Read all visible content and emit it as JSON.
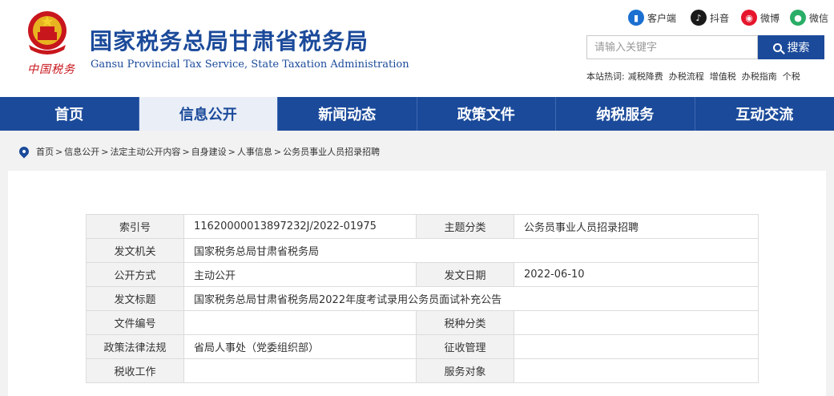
{
  "header": {
    "title": "国家税务总局甘肃省税务局",
    "subtitle": "Gansu Provincial Tax Service, State Taxation Administration",
    "seal_text": "中国税务"
  },
  "social": [
    {
      "label": "客户端",
      "icon": "mobile-app-icon",
      "color": "#1b6fd1"
    },
    {
      "label": "抖音",
      "icon": "douyin-icon",
      "color": "#1a1a1a"
    },
    {
      "label": "微博",
      "icon": "weibo-icon",
      "color": "#e6162d"
    },
    {
      "label": "微信",
      "icon": "wechat-icon",
      "color": "#2aae67"
    }
  ],
  "search": {
    "placeholder": "请输入关键字",
    "button_label": "搜索"
  },
  "hot": {
    "label": "本站热词:",
    "words": [
      "减税降费",
      "办税流程",
      "增值税",
      "办税指南",
      "个税"
    ]
  },
  "nav": [
    {
      "label": "首页",
      "active": false
    },
    {
      "label": "信息公开",
      "active": true
    },
    {
      "label": "新闻动态",
      "active": false
    },
    {
      "label": "政策文件",
      "active": false
    },
    {
      "label": "纳税服务",
      "active": false
    },
    {
      "label": "互动交流",
      "active": false
    }
  ],
  "breadcrumb": [
    "首页",
    "信息公开",
    "法定主动公开内容",
    "自身建设",
    "人事信息",
    "公务员事业人员招录招聘"
  ],
  "info_table": {
    "index_label": "索引号",
    "index_value": "11620000013897232J/2022-01975",
    "topic_label": "主题分类",
    "topic_value": "公务员事业人员招录招聘",
    "issuer_label": "发文机关",
    "issuer_value": "国家税务总局甘肃省税务局",
    "method_label": "公开方式",
    "method_value": "主动公开",
    "date_label": "发文日期",
    "date_value": "2022-06-10",
    "doc_title_label": "发文标题",
    "doc_title_value": "国家税务总局甘肃省税务局2022年度考试录用公务员面试补充公告",
    "doc_no_label": "文件编号",
    "doc_no_value": "",
    "tax_type_label": "税种分类",
    "tax_type_value": "",
    "policy_label": "政策法律法规",
    "policy_value": "省局人事处（党委组织部）",
    "collection_label": "征收管理",
    "collection_value": "",
    "tax_work_label": "税收工作",
    "tax_work_value": "",
    "service_label": "服务对象",
    "service_value": ""
  },
  "colors": {
    "brand_blue": "#1b4a9a",
    "seal_red": "#c8161d",
    "panel_gray": "#f2f2f2"
  }
}
